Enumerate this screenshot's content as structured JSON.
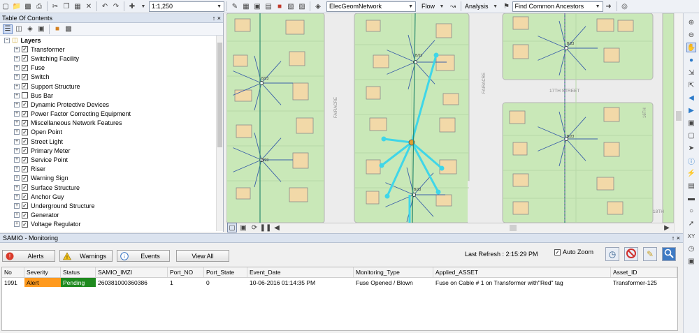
{
  "toolbar": {
    "scale": "1:1,250",
    "network": "ElecGeomNetwork",
    "flow": "Flow",
    "analysis": "Analysis",
    "trace_task": "Find Common Ancestors"
  },
  "toc": {
    "title": "Table Of Contents",
    "pin": "↑ ×",
    "root": "Layers",
    "layers": [
      {
        "label": "Transformer",
        "checked": true
      },
      {
        "label": "Switching Facility",
        "checked": true
      },
      {
        "label": "Fuse",
        "checked": true
      },
      {
        "label": "Switch",
        "checked": true
      },
      {
        "label": "Support Structure",
        "checked": true
      },
      {
        "label": "Bus Bar",
        "checked": false
      },
      {
        "label": "Dynamic Protective Devices",
        "checked": true
      },
      {
        "label": "Power Factor Correcting Equipment",
        "checked": true
      },
      {
        "label": "Miscellaneous Network Features",
        "checked": true
      },
      {
        "label": "Open Point",
        "checked": true
      },
      {
        "label": "Street Light",
        "checked": true
      },
      {
        "label": "Primary Meter",
        "checked": true
      },
      {
        "label": "Service Point",
        "checked": true
      },
      {
        "label": "Riser",
        "checked": true
      },
      {
        "label": "Warning Sign",
        "checked": true
      },
      {
        "label": "Surface Structure",
        "checked": true
      },
      {
        "label": "Anchor Guy",
        "checked": true
      },
      {
        "label": "Underground Structure",
        "checked": true
      },
      {
        "label": "Generator",
        "checked": true
      },
      {
        "label": "Voltage Regulator",
        "checked": true
      }
    ]
  },
  "map": {
    "street_labels": [
      "FAIRACRE",
      "FAIRACRE",
      "17TH STREET",
      "16TH",
      "18TH"
    ],
    "tags": [
      "B/23",
      "B/23",
      "B/23",
      "B/23",
      "B/23",
      "B/23"
    ]
  },
  "monitor": {
    "title": "SAMIO - Monitoring",
    "pin": "↑ ×",
    "buttons": {
      "alerts": "Alerts",
      "warnings": "Warnings",
      "events": "Events",
      "view_all": "View All"
    },
    "last_refresh_label": "Last Refresh : 2:15:29 PM",
    "auto_zoom_label": "Auto Zoom",
    "auto_zoom_checked": true,
    "columns": [
      "No",
      "Severity",
      "Status",
      "SAMIO_IMZI",
      "Port_NO",
      "Port_State",
      "Event_Date",
      "Monitoring_Type",
      "Applied_ASSET",
      "Asset_ID"
    ],
    "rows": [
      [
        "1991",
        "Alert",
        "Pending",
        "260381000360386",
        "1",
        "0",
        "10-06-2016 01:14:35 PM",
        "Fuse Opened / Blown",
        "Fuse on Cable # 1 on Transformer with\"Red\" tag",
        "Transformer-125"
      ]
    ]
  },
  "colors": {
    "alert": "#ff9a1e",
    "pending": "#1e8a1e",
    "parcel": "#c9e8b8",
    "building": "#f2d9a8",
    "highlight": "#3fd6e8"
  }
}
